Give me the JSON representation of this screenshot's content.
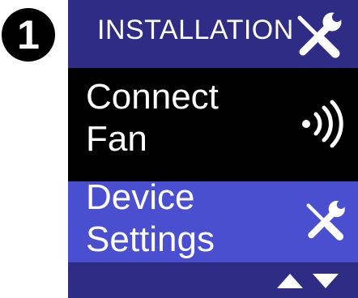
{
  "step": {
    "number": "1"
  },
  "header": {
    "title": "INSTALLATION",
    "icon": "wrench-screwdriver-icon"
  },
  "menu": {
    "items": [
      {
        "label_line1": "Connect",
        "label_line2": "Fan",
        "icon": "wireless-signal-icon",
        "selected": false
      },
      {
        "label_line1": "Device",
        "label_line2": "Settings",
        "icon": "wrench-screwdriver-icon",
        "selected": true
      }
    ]
  },
  "nav": {
    "up_icon": "triangle-up-icon",
    "down_icon": "triangle-down-icon"
  },
  "colors": {
    "header_bg": "#2f2c86",
    "selected_bg": "#4a4fd0",
    "item_bg": "#000000",
    "text": "#ffffff"
  }
}
